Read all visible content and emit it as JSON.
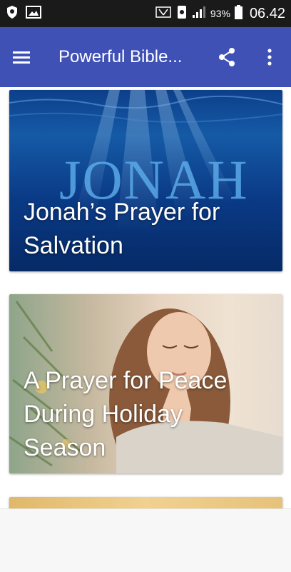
{
  "status_bar": {
    "battery_percent": "93%",
    "time": "06.42"
  },
  "app_bar": {
    "title": "Powerful Bible...",
    "color": "#3f51b5"
  },
  "feed": {
    "cards": [
      {
        "title": "Jonah’s Prayer for Salvation",
        "image_text": "JONAH"
      },
      {
        "title": "A Prayer for Peace During Holiday Season"
      },
      {
        "title": ""
      }
    ]
  }
}
